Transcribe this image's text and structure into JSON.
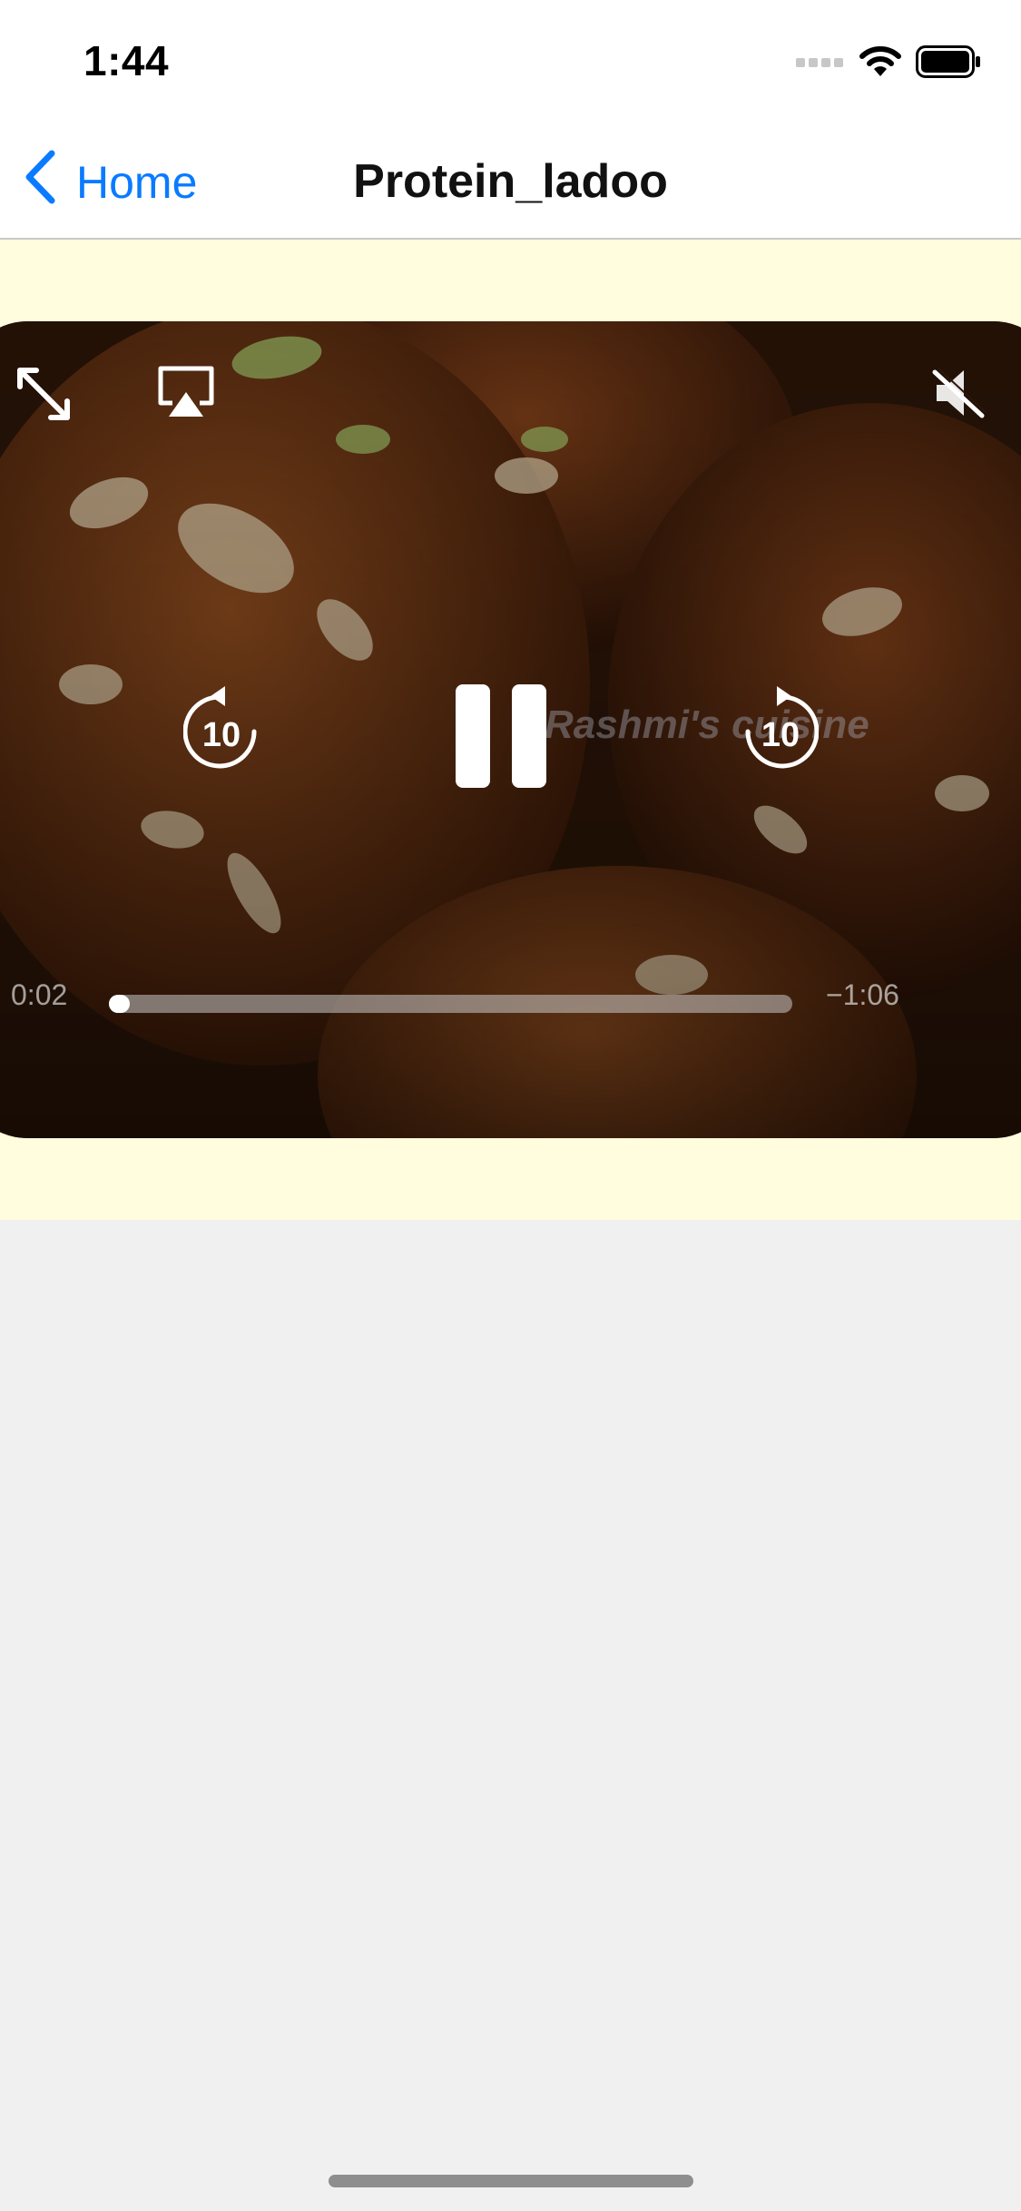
{
  "status_bar": {
    "time": "1:44",
    "icons": [
      "cellular-signal-icon",
      "wifi-icon",
      "battery-icon"
    ]
  },
  "nav": {
    "back_label": "Home",
    "title": "Protein_ladoo"
  },
  "video": {
    "watermark": "Rashmi's cuisine",
    "elapsed": "0:02",
    "remaining": "−1:06",
    "progress_fraction": 0.03,
    "skip_back_seconds": "10",
    "skip_forward_seconds": "10",
    "state": "playing",
    "muted": true,
    "icons": [
      "fullscreen-icon",
      "airplay-icon",
      "mute-icon",
      "skip-back-icon",
      "pause-icon",
      "skip-forward-icon"
    ]
  },
  "colors": {
    "accent": "#0a7bff",
    "content_background": "#fffdde",
    "page_background": "#f0f0f0"
  }
}
